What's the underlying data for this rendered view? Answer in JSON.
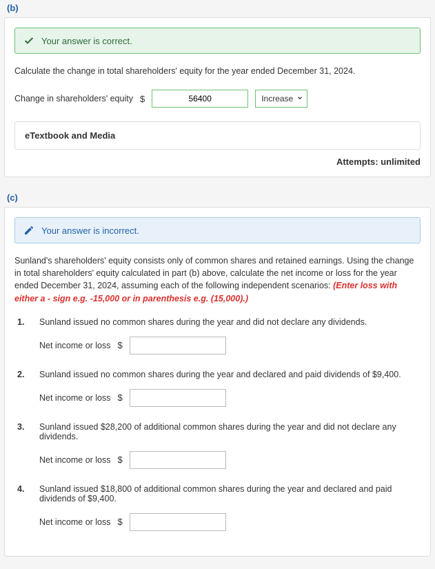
{
  "part_b": {
    "label": "(b)",
    "correct_msg": "Your answer is correct.",
    "instruction": "Calculate the change in total shareholders' equity for the year ended December 31, 2024.",
    "field_label": "Change in shareholders' equity",
    "currency": "$",
    "value": "56400",
    "direction": "Increase",
    "etextbook": "eTextbook and Media",
    "attempts": "Attempts: unlimited"
  },
  "part_c": {
    "label": "(c)",
    "incorrect_msg": "Your answer is incorrect.",
    "intro_1": "Sunland's shareholders' equity consists only of common shares and retained earnings. Using the change in total shareholders' equity calculated in part (b) above, calculate the net income or loss for the year ended December 31, 2024, assuming each of the following independent scenarios: ",
    "intro_hint": "(Enter loss with either a - sign e.g. -15,000 or in parenthesis e.g. (15,000).)",
    "net_label": "Net income or loss",
    "currency": "$",
    "scenarios": [
      {
        "num": "1.",
        "text": "Sunland issued no common shares during the year and did not declare any dividends."
      },
      {
        "num": "2.",
        "text": "Sunland issued no common shares during the year and declared and paid dividends of $9,400."
      },
      {
        "num": "3.",
        "text": "Sunland issued $28,200 of additional common shares during the year and did not declare any dividends."
      },
      {
        "num": "4.",
        "text": "Sunland issued $18,800 of additional common shares during the year and declared and paid dividends of $9,400."
      }
    ]
  }
}
